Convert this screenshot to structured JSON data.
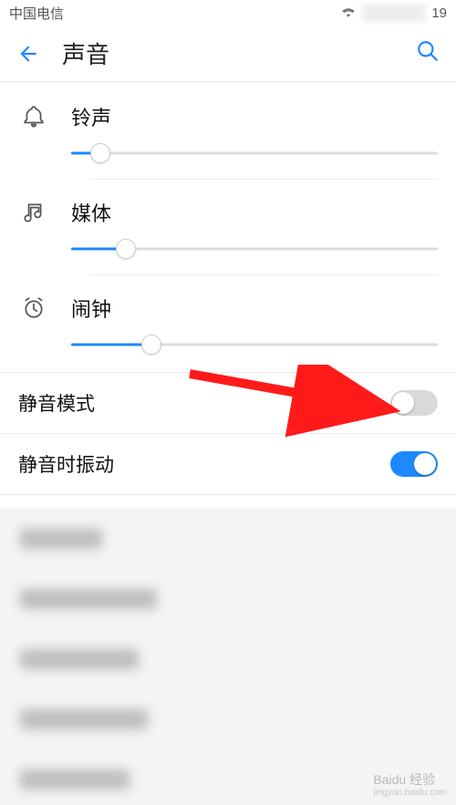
{
  "statusbar": {
    "carrier": "中国电信",
    "clock_partial": "19"
  },
  "header": {
    "title": "声音"
  },
  "volumes": {
    "ringtone": {
      "label": "铃声",
      "percent": 8
    },
    "media": {
      "label": "媒体",
      "percent": 15
    },
    "alarm": {
      "label": "闹钟",
      "percent": 22
    }
  },
  "switches": {
    "silent": {
      "label": "静音模式",
      "on": false
    },
    "vibrate": {
      "label": "静音时振动",
      "on": true
    }
  },
  "icons": {
    "back": "back-arrow-icon",
    "search": "search-icon",
    "ringtone": "bell-icon",
    "media": "music-note-icon",
    "alarm": "alarm-clock-icon",
    "wifi": "wifi-icon"
  },
  "colors": {
    "accent": "#1e88ff",
    "track": "#dcdcdc",
    "toggle_off": "#d9d9d9"
  },
  "annotation": {
    "arrow_color": "#ff1a1a",
    "arrow_target": "silent-mode-toggle"
  },
  "watermark": {
    "main": "Baidu 经验",
    "sub": "jingyan.baidu.com"
  }
}
